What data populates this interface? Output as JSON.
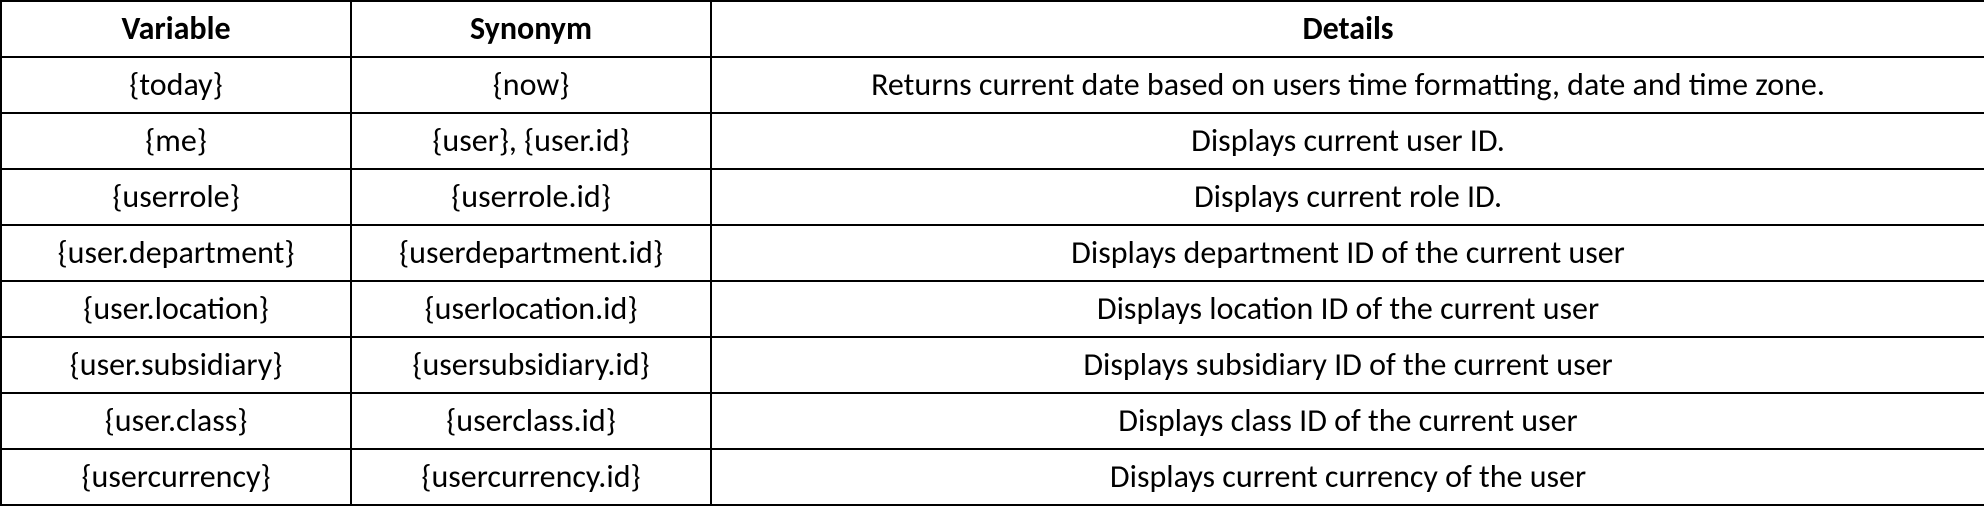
{
  "table": {
    "headers": {
      "variable": "Variable",
      "synonym": "Synonym",
      "details": "Details"
    },
    "rows": [
      {
        "variable": "{today}",
        "synonym": "{now}",
        "details": "Returns current date based on users time formatting, date and time zone."
      },
      {
        "variable": "{me}",
        "synonym": "{user}, {user.id}",
        "details": "Displays current user ID."
      },
      {
        "variable": "{userrole}",
        "synonym": "{userrole.id}",
        "details": "Displays current role ID."
      },
      {
        "variable": "{user.department}",
        "synonym": "{userdepartment.id}",
        "details": "Displays department ID of the current user"
      },
      {
        "variable": "{user.location}",
        "synonym": "{userlocation.id}",
        "details": "Displays location ID of the current user"
      },
      {
        "variable": "{user.subsidiary}",
        "synonym": "{usersubsidiary.id}",
        "details": "Displays subsidiary ID of the current user"
      },
      {
        "variable": "{user.class}",
        "synonym": "{userclass.id}",
        "details": "Displays class ID of the current user"
      },
      {
        "variable": "{usercurrency}",
        "synonym": "{usercurrency.id}",
        "details": "Displays current currency of the user"
      }
    ]
  }
}
